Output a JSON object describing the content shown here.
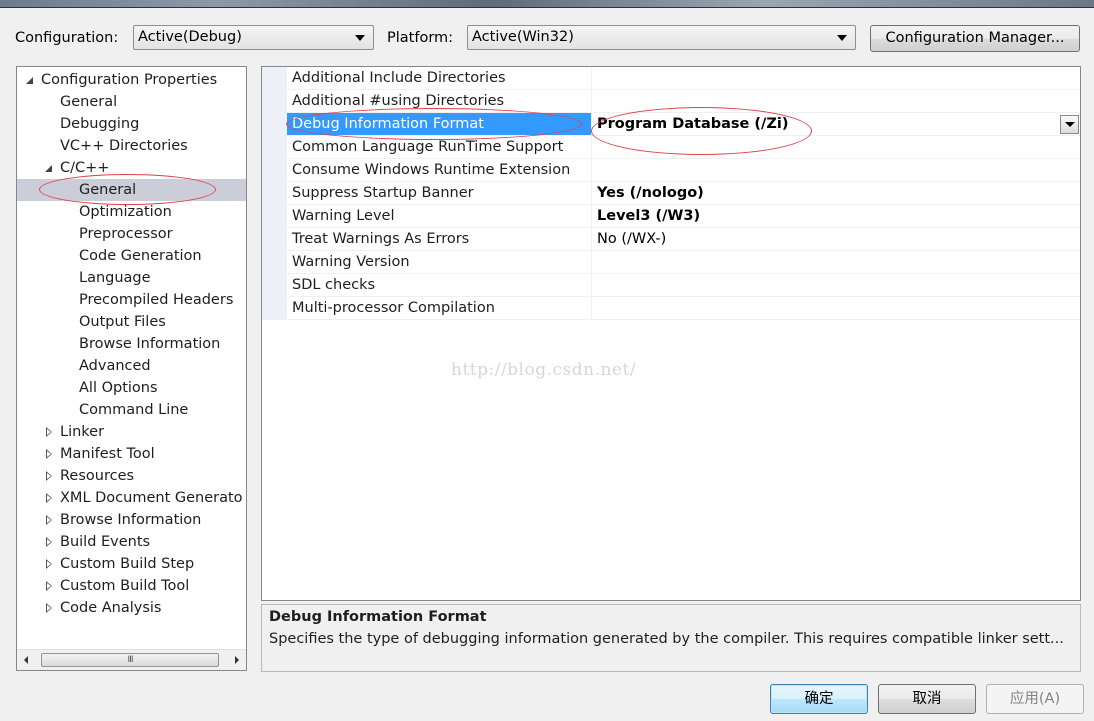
{
  "toolbar": {
    "configuration_label": "Configuration:",
    "configuration_value": "Active(Debug)",
    "platform_label": "Platform:",
    "platform_value": "Active(Win32)",
    "config_manager_button": "Configuration Manager..."
  },
  "tree": {
    "items": [
      {
        "label": "Configuration Properties",
        "level": 0,
        "state": "expanded"
      },
      {
        "label": "General",
        "level": 1,
        "state": "leaf"
      },
      {
        "label": "Debugging",
        "level": 1,
        "state": "leaf"
      },
      {
        "label": "VC++ Directories",
        "level": 1,
        "state": "leaf"
      },
      {
        "label": "C/C++",
        "level": 1,
        "state": "expanded"
      },
      {
        "label": "General",
        "level": 2,
        "state": "leaf",
        "selected": true
      },
      {
        "label": "Optimization",
        "level": 2,
        "state": "leaf"
      },
      {
        "label": "Preprocessor",
        "level": 2,
        "state": "leaf"
      },
      {
        "label": "Code Generation",
        "level": 2,
        "state": "leaf"
      },
      {
        "label": "Language",
        "level": 2,
        "state": "leaf"
      },
      {
        "label": "Precompiled Headers",
        "level": 2,
        "state": "leaf"
      },
      {
        "label": "Output Files",
        "level": 2,
        "state": "leaf"
      },
      {
        "label": "Browse Information",
        "level": 2,
        "state": "leaf"
      },
      {
        "label": "Advanced",
        "level": 2,
        "state": "leaf"
      },
      {
        "label": "All Options",
        "level": 2,
        "state": "leaf"
      },
      {
        "label": "Command Line",
        "level": 2,
        "state": "leaf"
      },
      {
        "label": "Linker",
        "level": 1,
        "state": "collapsed"
      },
      {
        "label": "Manifest Tool",
        "level": 1,
        "state": "collapsed"
      },
      {
        "label": "Resources",
        "level": 1,
        "state": "collapsed"
      },
      {
        "label": "XML Document Generato",
        "level": 1,
        "state": "collapsed"
      },
      {
        "label": "Browse Information",
        "level": 1,
        "state": "collapsed"
      },
      {
        "label": "Build Events",
        "level": 1,
        "state": "collapsed"
      },
      {
        "label": "Custom Build Step",
        "level": 1,
        "state": "collapsed"
      },
      {
        "label": "Custom Build Tool",
        "level": 1,
        "state": "collapsed"
      },
      {
        "label": "Code Analysis",
        "level": 1,
        "state": "collapsed"
      }
    ],
    "scrollbar_grip": "III"
  },
  "properties": {
    "rows": [
      {
        "name": "Additional Include Directories",
        "value": "",
        "bold": false
      },
      {
        "name": "Additional #using Directories",
        "value": "",
        "bold": false
      },
      {
        "name": "Debug Information Format",
        "value": "Program Database (/Zi)",
        "bold": true,
        "selected": true
      },
      {
        "name": "Common Language RunTime Support",
        "value": "",
        "bold": false
      },
      {
        "name": "Consume Windows Runtime Extension",
        "value": "",
        "bold": false
      },
      {
        "name": "Suppress Startup Banner",
        "value": "Yes (/nologo)",
        "bold": true
      },
      {
        "name": "Warning Level",
        "value": "Level3 (/W3)",
        "bold": true
      },
      {
        "name": "Treat Warnings As Errors",
        "value": "No (/WX-)",
        "bold": false
      },
      {
        "name": "Warning Version",
        "value": "",
        "bold": false
      },
      {
        "name": "SDL checks",
        "value": "",
        "bold": false
      },
      {
        "name": "Multi-processor Compilation",
        "value": "",
        "bold": false
      }
    ]
  },
  "watermark": "http://blog.csdn.net/",
  "description": {
    "title": "Debug Information Format",
    "text": "Specifies the type of debugging information generated by the compiler.  This requires compatible linker sett..."
  },
  "buttons": {
    "ok": "确定",
    "cancel": "取消",
    "apply": "应用(A)"
  },
  "annotation_color": "#e0414a",
  "selection_color": "#3399ff"
}
